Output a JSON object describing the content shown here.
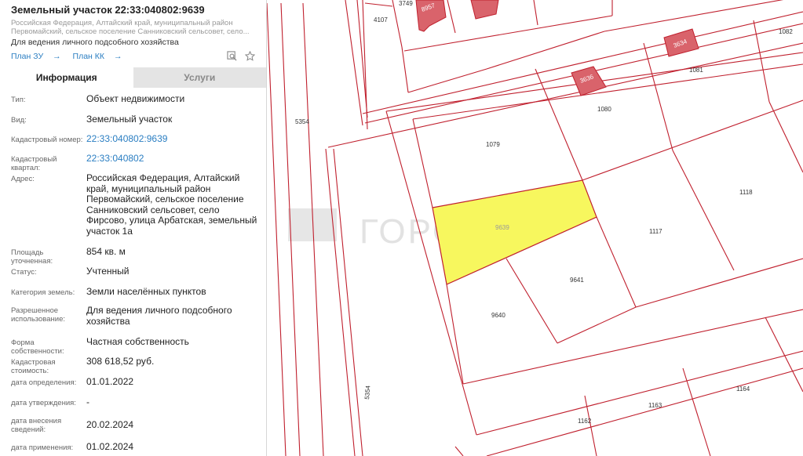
{
  "header": {
    "title": "Земельный участок 22:33:040802:9639",
    "address_line1": "Российская Федерация, Алтайский край, муниципальный район",
    "address_line2": "Первомайский, сельское поселение Санниковский сельсовет, село...",
    "purpose": "Для ведения личного подсобного хозяйства",
    "link_plan_zu": "План ЗУ",
    "link_plan_kk": "План КК"
  },
  "tabs": {
    "info": "Информация",
    "services": "Услуги"
  },
  "details": {
    "type_label": "Тип:",
    "type_value": "Объект недвижимости",
    "kind_label": "Вид:",
    "kind_value": "Земельный участок",
    "cadnum_label": "Кадастровый номер:",
    "cadnum_value": "22:33:040802:9639",
    "quarter_label": "Кадастровый квартал:",
    "quarter_value": "22:33:040802",
    "address_label": "Адрес:",
    "address_value": "Российская Федерация, Алтайский край, муниципальный район Первомайский, сельское поселение Санниковский сельсовет, село Фирсово, улица Арбатская, земельный участок 1а",
    "area_label": "Площадь уточненная:",
    "area_value": "854 кв. м",
    "status_label": "Статус:",
    "status_value": "Учтенный",
    "category_label": "Категория земель:",
    "category_value": "Земли населённых пунктов",
    "usage_label": "Разрешенное использование:",
    "usage_value": "Для ведения личного подсобного хозяйства",
    "ownership_label": "Форма собственности:",
    "ownership_value": "Частная собственность",
    "cost_label": "Кадастровая стоимость:",
    "cost_value": "308 618,52 руб.",
    "det_date_label": "дата определения:",
    "det_date_value": "01.01.2022",
    "approve_date_label": "дата утверждения:",
    "approve_date_value": "-",
    "entry_date_label": "дата внесения сведений:",
    "entry_date_value": "20.02.2024",
    "apply_date_label": "дата применения:",
    "apply_date_value": "01.02.2024"
  },
  "map": {
    "watermark": "ГОРОДА",
    "parcel_labels": {
      "p4107": "4107",
      "p3749": "3749",
      "p8957": "8957",
      "p1082": "1082",
      "p3634": "3634",
      "p1081": "1081",
      "p3636": "3636",
      "p1080": "1080",
      "p5354a": "5354",
      "p1079": "1079",
      "p1118": "1118",
      "p9639": "9639",
      "p1117": "1117",
      "p9641": "9641",
      "p9640": "9640",
      "p5354b": "5354",
      "p1164": "1164",
      "p1163": "1163",
      "p1162": "1162"
    },
    "colors": {
      "boundary": "#c0202e",
      "building": "#d9636b",
      "highlight": "#f7f75e"
    }
  }
}
